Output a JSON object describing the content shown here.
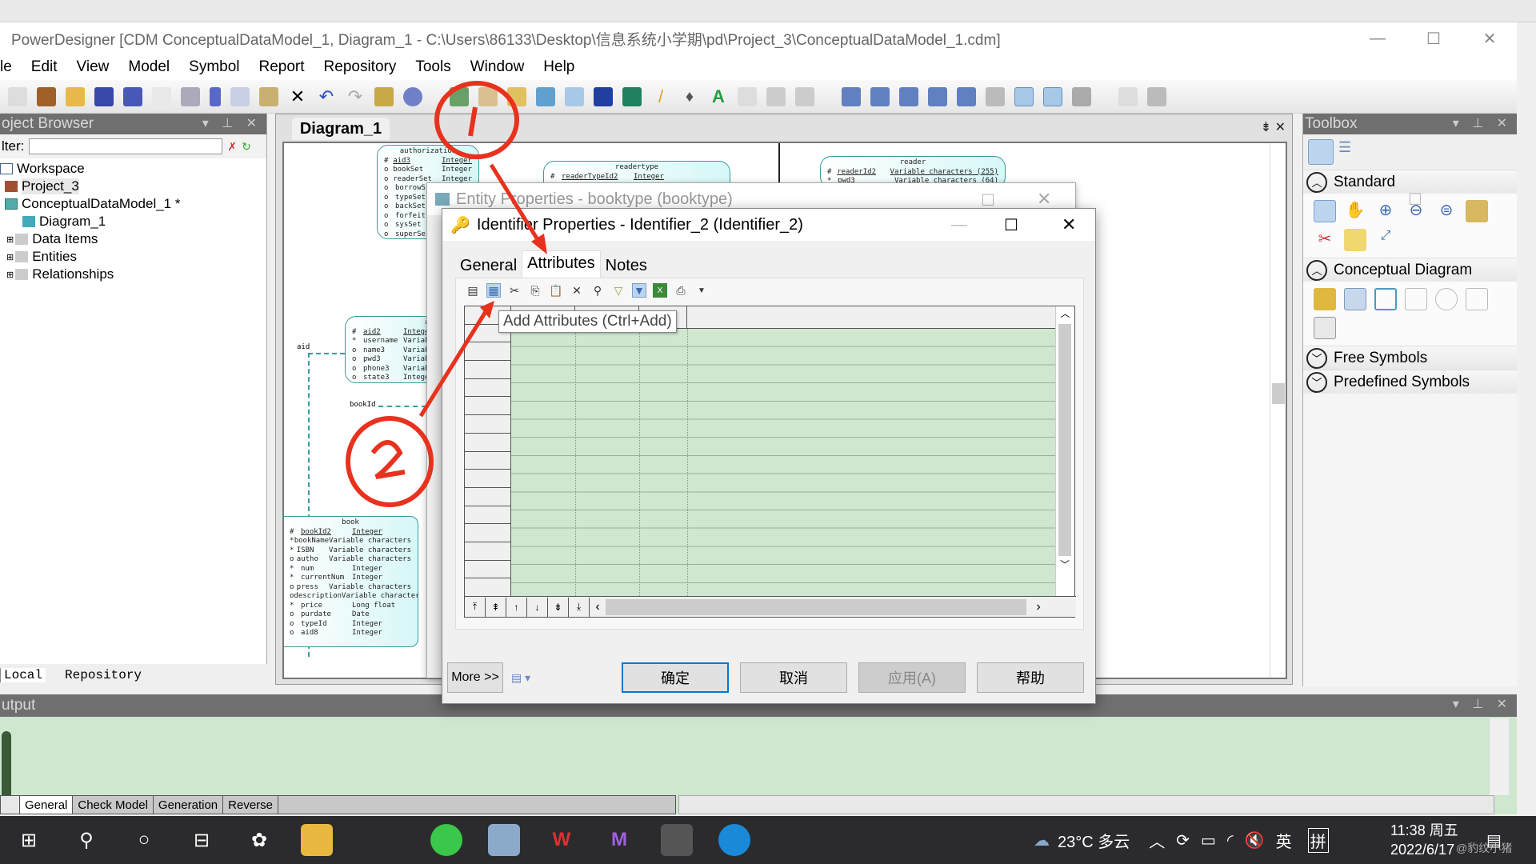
{
  "app": {
    "title": "PowerDesigner [CDM ConceptualDataModel_1, Diagram_1 - C:\\Users\\86133\\Desktop\\信息系统小学期\\pd\\Project_3\\ConceptualDataModel_1.cdm]"
  },
  "menu": [
    "le",
    "Edit",
    "View",
    "Model",
    "Symbol",
    "Report",
    "Repository",
    "Tools",
    "Window",
    "Help"
  ],
  "project_browser": {
    "title": "oject Browser",
    "filter_label": "lter:",
    "filter_value": "",
    "tree": [
      {
        "label": "Workspace",
        "icon": "workspace-icon"
      },
      {
        "label": "Project_3",
        "icon": "project-icon"
      },
      {
        "label": "ConceptualDataModel_1 *",
        "icon": "model-icon"
      },
      {
        "label": "Diagram_1",
        "icon": "diagram-icon"
      },
      {
        "label": "Data Items",
        "icon": "folder-icon"
      },
      {
        "label": "Entities",
        "icon": "folder-icon"
      },
      {
        "label": "Relationships",
        "icon": "folder-icon"
      }
    ],
    "tabs": [
      "Local",
      "Repository"
    ]
  },
  "diagram": {
    "tab": "Diagram_1",
    "entities": {
      "authorization": {
        "name": "authorization",
        "rows": [
          [
            "#",
            "aid3",
            "Integer"
          ],
          [
            "o",
            "bookSet",
            "Integer"
          ],
          [
            "o",
            "readerSet",
            "Integer"
          ],
          [
            "o",
            "borrowS",
            ""
          ],
          [
            "o",
            "typeSet",
            ""
          ],
          [
            "o",
            "backSet",
            ""
          ],
          [
            "o",
            "forfeit",
            ""
          ],
          [
            "o",
            "sysSet",
            ""
          ],
          [
            "o",
            "superSe",
            ""
          ]
        ]
      },
      "readertype": {
        "name": "readertype",
        "rows": [
          [
            "#",
            "readerTypeId2",
            "Integer"
          ]
        ]
      },
      "reader": {
        "name": "reader",
        "rows": [
          [
            "#",
            "readerId2",
            "Variable characters (255)"
          ],
          [
            "*",
            "pwd3",
            "Variable characters (64)"
          ]
        ]
      },
      "admin": {
        "name": "ad",
        "rows": [
          [
            "#",
            "aid2",
            "Intege"
          ],
          [
            "*",
            "username",
            "Variab"
          ],
          [
            "o",
            "name3",
            "Variab"
          ],
          [
            "o",
            "pwd3",
            "Variab"
          ],
          [
            "o",
            "phone3",
            "Variab"
          ],
          [
            "o",
            "state3",
            "Intege"
          ]
        ]
      },
      "book": {
        "name": "book",
        "rows": [
          [
            "#",
            "bookId2",
            "Integer"
          ],
          [
            "*",
            "bookName",
            "Variable characters"
          ],
          [
            "*",
            "ISBN",
            "Variable characters"
          ],
          [
            "o",
            "autho",
            "Variable characters"
          ],
          [
            "*",
            "num",
            "Integer"
          ],
          [
            "*",
            "currentNum",
            "Integer"
          ],
          [
            "o",
            "press",
            "Variable characters"
          ],
          [
            "o",
            "description",
            "Variable characters"
          ],
          [
            "*",
            "price",
            "Long float"
          ],
          [
            "o",
            "purdate",
            "Date"
          ],
          [
            "o",
            "typeId",
            "Integer"
          ],
          [
            "o",
            "aid8",
            "Integer"
          ]
        ]
      }
    },
    "link_labels": {
      "aid": "aid",
      "bookId": "bookId"
    }
  },
  "toolbox": {
    "title": "Toolbox",
    "sections": [
      {
        "label": "Standard",
        "expanded": true
      },
      {
        "label": "Conceptual Diagram",
        "expanded": true
      },
      {
        "label": "Free Symbols",
        "expanded": false
      },
      {
        "label": "Predefined Symbols",
        "expanded": false
      }
    ]
  },
  "entity_dialog": {
    "title": "Entity Properties - booktype (booktype)"
  },
  "identifier_dialog": {
    "title": "Identifier Properties - Identifier_2 (Identifier_2)",
    "tabs": [
      "General",
      "Attributes",
      "Notes"
    ],
    "active_tab": "Attributes",
    "tooltip": "Add Attributes (Ctrl+Add)",
    "buttons": {
      "more": "More >>",
      "ok": "确定",
      "cancel": "取消",
      "apply": "应用(A)",
      "help": "帮助"
    }
  },
  "output": {
    "title": "utput",
    "tabs": [
      "General",
      "Check Model",
      "Generation",
      "Reverse"
    ]
  },
  "taskbar": {
    "weather": "23°C 多云",
    "ime_lang": "英",
    "ime_mode": "拼",
    "time": "11:38 周五",
    "date": "2022/6/17",
    "watermark": "@豹纹小猪"
  },
  "annotations": {
    "step1": "1",
    "step2": "2",
    "color": "#e8321e"
  }
}
